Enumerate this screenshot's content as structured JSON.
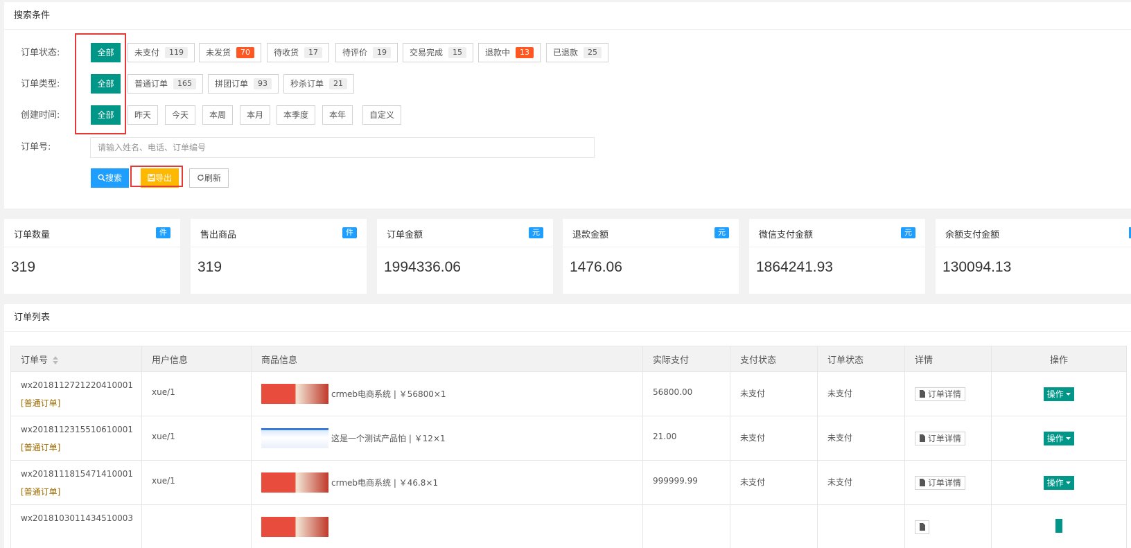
{
  "search": {
    "title": "搜索条件",
    "status_label": "订单状态:",
    "status_options": [
      {
        "label": "全部",
        "count": null,
        "active": true
      },
      {
        "label": "未支付",
        "count": "119"
      },
      {
        "label": "未发货",
        "count": "70",
        "highlight": true
      },
      {
        "label": "待收货",
        "count": "17"
      },
      {
        "label": "待评价",
        "count": "19"
      },
      {
        "label": "交易完成",
        "count": "15"
      },
      {
        "label": "退款中",
        "count": "13",
        "highlight": true
      },
      {
        "label": "已退款",
        "count": "25"
      }
    ],
    "type_label": "订单类型:",
    "type_options": [
      {
        "label": "全部",
        "active": true
      },
      {
        "label": "普通订单",
        "count": "165"
      },
      {
        "label": "拼团订单",
        "count": "93"
      },
      {
        "label": "秒杀订单",
        "count": "21"
      }
    ],
    "time_label": "创建时间:",
    "time_options": [
      "全部",
      "昨天",
      "今天",
      "本周",
      "本月",
      "本季度",
      "本年",
      "自定义"
    ],
    "order_no_label": "订单号:",
    "order_no_placeholder": "请输入姓名、电话、订单编号",
    "search_btn": "搜索",
    "export_btn": "导出",
    "refresh_btn": "刷新"
  },
  "stats": [
    {
      "title": "订单数量",
      "unit": "件",
      "value": "319"
    },
    {
      "title": "售出商品",
      "unit": "件",
      "value": "319"
    },
    {
      "title": "订单金额",
      "unit": "元",
      "value": "1994336.06"
    },
    {
      "title": "退款金额",
      "unit": "元",
      "value": "1476.06"
    },
    {
      "title": "微信支付金额",
      "unit": "元",
      "value": "1864241.93"
    },
    {
      "title": "余额支付金额",
      "unit": "",
      "value": "130094.13"
    }
  ],
  "list": {
    "title": "订单列表",
    "columns": [
      "订单号",
      "用户信息",
      "商品信息",
      "实际支付",
      "支付状态",
      "订单状态",
      "详情",
      "操作"
    ],
    "detail_btn": "订单详情",
    "op_btn": "操作",
    "rows": [
      {
        "order_no": "wx2018112721220410001",
        "type": "[普通订单]",
        "user": "xue/1",
        "product": "crmeb电商系统 | ￥56800×1",
        "thumb": "red",
        "paid": "56800.00",
        "pay_status": "未支付",
        "order_status": "未支付"
      },
      {
        "order_no": "wx2018112315510610001",
        "type": "[普通订单]",
        "user": "xue/1",
        "product": "这是一个测试产品怕 | ￥12×1",
        "thumb": "blue",
        "paid": "21.00",
        "pay_status": "未支付",
        "order_status": "未支付"
      },
      {
        "order_no": "wx2018111815471410001",
        "type": "[普通订单]",
        "user": "xue/1",
        "product": "crmeb电商系统 | ￥46.8×1",
        "thumb": "red",
        "paid": "999999.99",
        "pay_status": "未支付",
        "order_status": "未支付"
      },
      {
        "order_no": "wx2018103011434510003",
        "type": "",
        "user": "",
        "product": "",
        "thumb": "red",
        "paid": "",
        "pay_status": "",
        "order_status": ""
      }
    ]
  }
}
